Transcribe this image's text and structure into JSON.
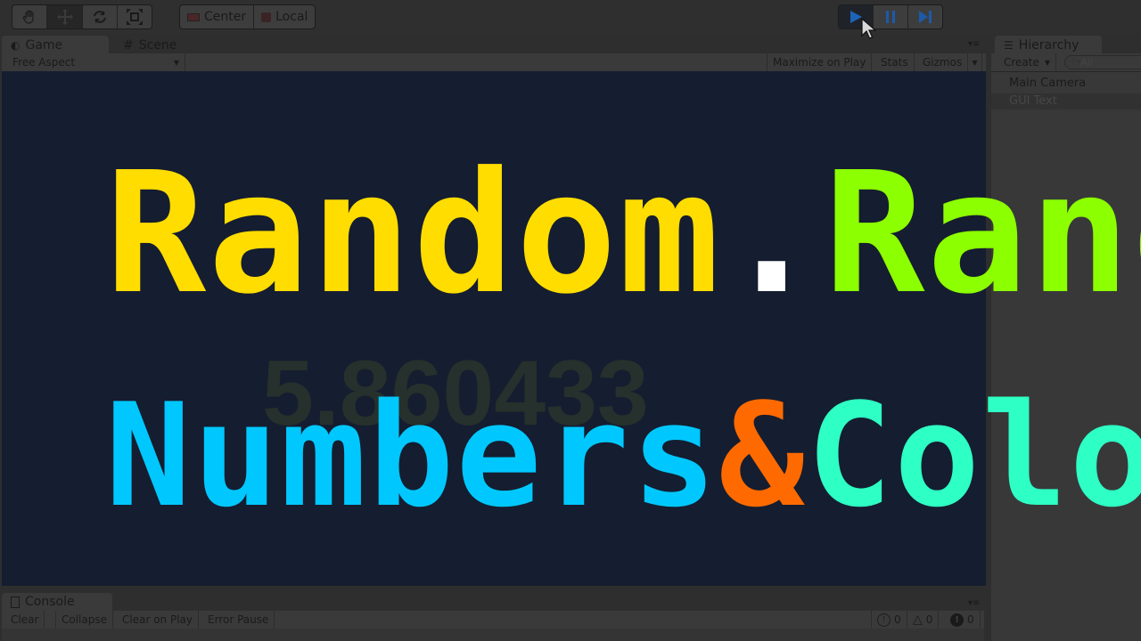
{
  "toolbar": {
    "tools": [
      {
        "name": "hand-tool",
        "icon": "hand-icon",
        "active": false
      },
      {
        "name": "move-tool",
        "icon": "move-arrows-icon",
        "active": true
      },
      {
        "name": "rotate-tool",
        "icon": "rotate-icon",
        "active": false
      },
      {
        "name": "scale-tool",
        "icon": "scale-icon",
        "active": false
      }
    ],
    "pivot_mode": "Center",
    "pivot_rotation": "Local",
    "playback": [
      {
        "name": "play",
        "icon": "play-icon",
        "active": true
      },
      {
        "name": "pause",
        "icon": "pause-icon",
        "active": false
      },
      {
        "name": "step",
        "icon": "step-icon",
        "active": false
      }
    ],
    "accent_color": "#1d63b8"
  },
  "game_panel": {
    "tabs": [
      {
        "label": "Game",
        "icon": "game-controller-icon",
        "active": true
      },
      {
        "label": "Scene",
        "icon": "grid-hash-icon",
        "active": false
      }
    ],
    "aspect": "Free Aspect",
    "maximize_on_play": "Maximize on Play",
    "stats": "Stats",
    "gizmos": "Gizmos"
  },
  "game_view": {
    "background": "#151d30",
    "random_value": "5.860433",
    "title_line1": [
      {
        "text": "Random",
        "color": "#ffdd00"
      },
      {
        "text": ".",
        "color": "#ffffff"
      },
      {
        "text": "Range",
        "color": "#8cff00"
      },
      {
        "text": "()",
        "color": "#ffffff"
      }
    ],
    "title_line2": [
      {
        "text": "Numbers",
        "color": "#00c8ff"
      },
      {
        "text": "&",
        "color": "#ff6a00"
      },
      {
        "text": "Colors",
        "color": "#2effc4"
      }
    ]
  },
  "hierarchy": {
    "tab_label": "Hierarchy",
    "create_label": "Create",
    "search_placeholder": "All",
    "items": [
      {
        "label": "Main Camera",
        "selected": false
      },
      {
        "label": "GUI Text",
        "selected": true
      }
    ]
  },
  "console": {
    "tab_label": "Console",
    "buttons": [
      "Clear",
      "Collapse",
      "Clear on Play",
      "Error Pause"
    ],
    "counts": {
      "info": "0",
      "warning": "0",
      "error": "0"
    }
  }
}
